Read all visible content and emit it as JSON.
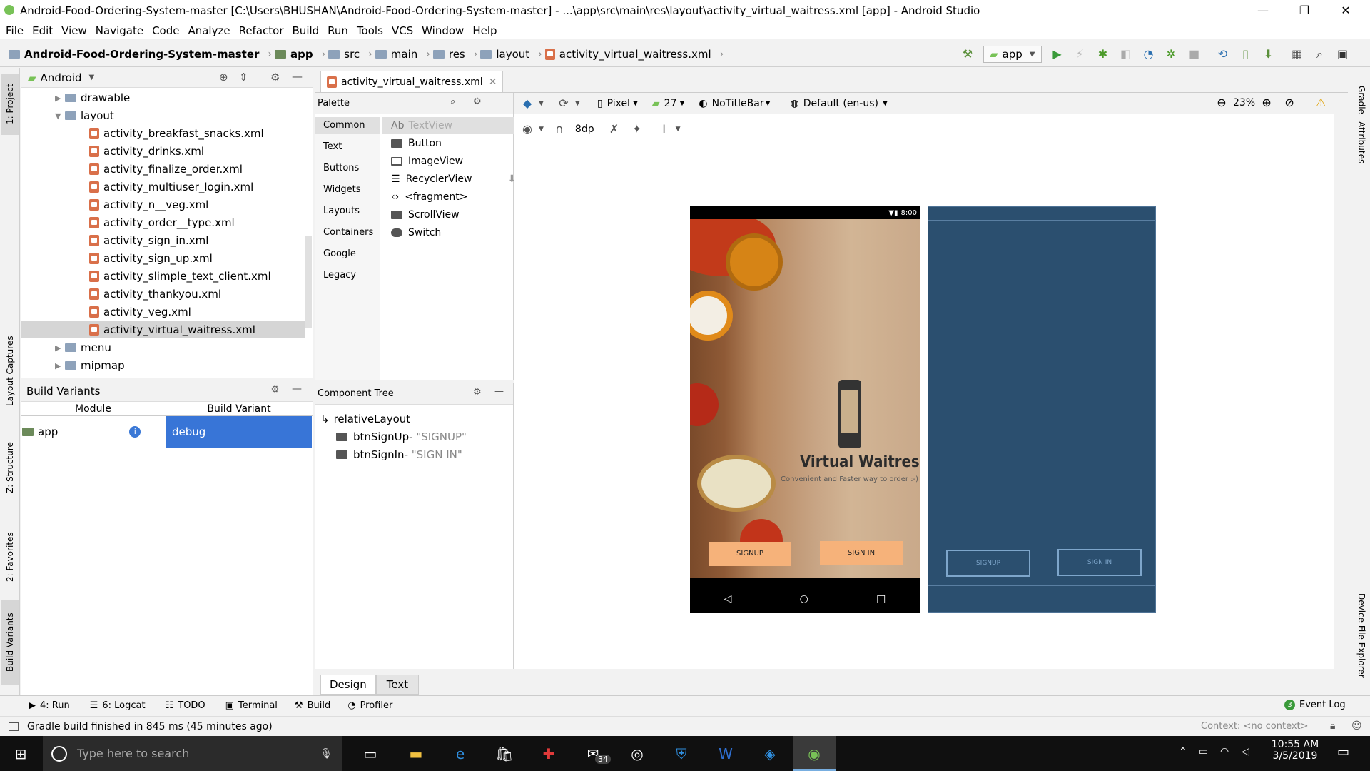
{
  "window": {
    "title": "Android-Food-Ordering-System-master [C:\\Users\\BHUSHAN\\Android-Food-Ordering-System-master] - ...\\app\\src\\main\\res\\layout\\activity_virtual_waitress.xml [app] - Android Studio",
    "minimize": "—",
    "maximize": "❐",
    "close": "✕"
  },
  "menu": [
    "File",
    "Edit",
    "View",
    "Navigate",
    "Code",
    "Analyze",
    "Refactor",
    "Build",
    "Run",
    "Tools",
    "VCS",
    "Window",
    "Help"
  ],
  "breadcrumb": [
    "Android-Food-Ordering-System-master",
    "app",
    "src",
    "main",
    "res",
    "layout",
    "activity_virtual_waitress.xml"
  ],
  "run_config": "app",
  "project_panel": {
    "view_mode": "Android",
    "items": [
      {
        "label": "drawable",
        "type": "folder",
        "level": 1,
        "expanded": false
      },
      {
        "label": "layout",
        "type": "folder",
        "level": 1,
        "expanded": true
      },
      {
        "label": "activity_breakfast_snacks.xml",
        "type": "xml",
        "level": 2
      },
      {
        "label": "activity_drinks.xml",
        "type": "xml",
        "level": 2
      },
      {
        "label": "activity_finalize_order.xml",
        "type": "xml",
        "level": 2
      },
      {
        "label": "activity_multiuser_login.xml",
        "type": "xml",
        "level": 2
      },
      {
        "label": "activity_n__veg.xml",
        "type": "xml",
        "level": 2
      },
      {
        "label": "activity_order__type.xml",
        "type": "xml",
        "level": 2
      },
      {
        "label": "activity_sign_in.xml",
        "type": "xml",
        "level": 2
      },
      {
        "label": "activity_sign_up.xml",
        "type": "xml",
        "level": 2
      },
      {
        "label": "activity_slimple_text_client.xml",
        "type": "xml",
        "level": 2
      },
      {
        "label": "activity_thankyou.xml",
        "type": "xml",
        "level": 2
      },
      {
        "label": "activity_veg.xml",
        "type": "xml",
        "level": 2
      },
      {
        "label": "activity_virtual_waitress.xml",
        "type": "xml",
        "level": 2,
        "selected": true
      },
      {
        "label": "menu",
        "type": "folder",
        "level": 1,
        "expanded": false
      },
      {
        "label": "mipmap",
        "type": "folder",
        "level": 1,
        "expanded": false
      }
    ]
  },
  "build_variants": {
    "title": "Build Variants",
    "col_module": "Module",
    "col_variant": "Build Variant",
    "module": "app",
    "variant": "debug"
  },
  "left_tabs": [
    "1: Project",
    "Layout Captures",
    "Z: Structure",
    "2: Favorites",
    "Build Variants"
  ],
  "right_tabs": [
    "Gradle",
    "Attributes",
    "Device File Explorer"
  ],
  "editor_tab": "activity_virtual_waitress.xml",
  "palette": {
    "title": "Palette",
    "categories": [
      "Common",
      "Text",
      "Buttons",
      "Widgets",
      "Layouts",
      "Containers",
      "Google",
      "Legacy"
    ],
    "items": [
      {
        "label": "TextView",
        "prefix": "Ab"
      },
      {
        "label": "Button"
      },
      {
        "label": "ImageView"
      },
      {
        "label": "RecyclerView"
      },
      {
        "label": "<fragment>"
      },
      {
        "label": "ScrollView"
      },
      {
        "label": "Switch"
      }
    ]
  },
  "component_tree": {
    "title": "Component Tree",
    "root": "relativeLayout",
    "children": [
      {
        "id": "btnSignUp",
        "text": "- \"SIGNUP\""
      },
      {
        "id": "btnSignIn",
        "text": "- \"SIGN IN\""
      }
    ]
  },
  "design_toolbar": {
    "device": "Pixel",
    "api": "27",
    "theme": "NoTitleBar",
    "locale": "Default (en-us)",
    "zoom": "23%",
    "margin": "8dp"
  },
  "phone": {
    "time": "8:00",
    "app_title": "Virtual Waitress",
    "tagline": "Convenient and Faster way to order :-)",
    "signup": "SIGNUP",
    "signin": "SIGN IN"
  },
  "editor_modes": [
    "Design",
    "Text"
  ],
  "tool_windows": [
    "4: Run",
    "6: Logcat",
    "TODO",
    "Terminal",
    "Build",
    "Profiler"
  ],
  "event_log": "Event Log",
  "event_log_count": "3",
  "status_message": "Gradle build finished in 845 ms (45 minutes ago)",
  "context": "Context: <no context>",
  "taskbar": {
    "search_placeholder": "Type here to search",
    "time": "10:55 AM",
    "date": "3/5/2019",
    "mail_badge": "34"
  },
  "colors": {
    "selection": "#3875d7",
    "blueprint": "#2b4f6f",
    "button": "#f6b27a"
  }
}
